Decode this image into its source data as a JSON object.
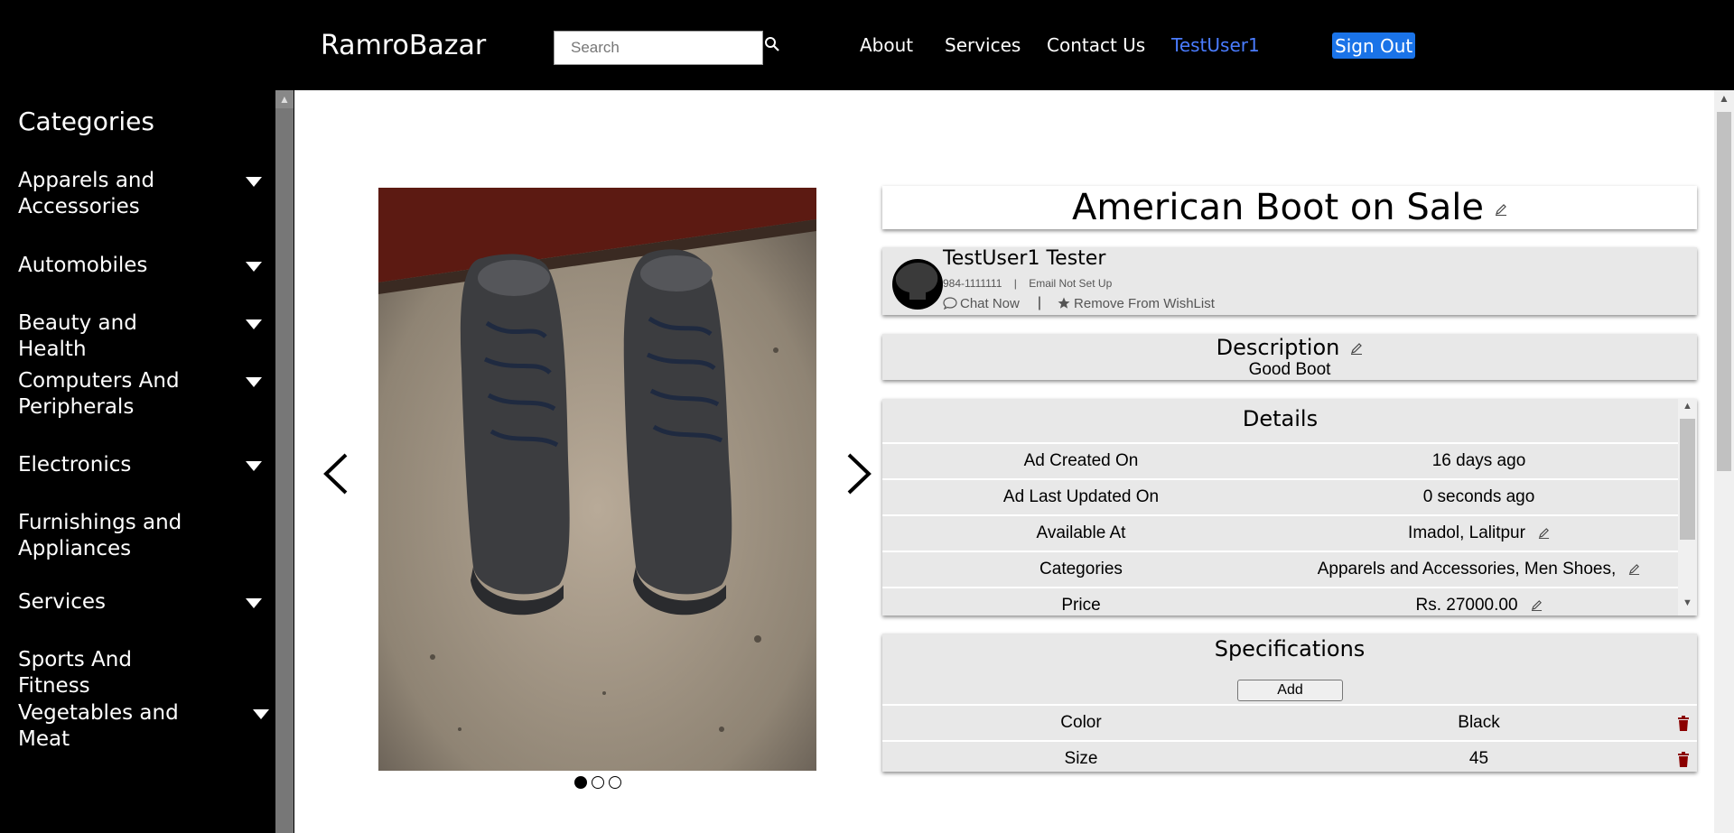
{
  "header": {
    "brand": "RamroBazar",
    "search_placeholder": "Search",
    "nav": {
      "about": "About",
      "services": "Services",
      "contact": "Contact Us",
      "user": "TestUser1"
    },
    "signout": "Sign Out"
  },
  "sidebar": {
    "title": "Categories",
    "items": [
      {
        "label": "Apparels and Accessories",
        "expandable": true
      },
      {
        "label": "Automobiles",
        "expandable": true
      },
      {
        "label": "Beauty and Health",
        "expandable": true
      },
      {
        "label": "Computers And Peripherals",
        "expandable": true
      },
      {
        "label": "Electronics",
        "expandable": true
      },
      {
        "label": "Furnishings and Appliances",
        "expandable": false
      },
      {
        "label": "Services",
        "expandable": true
      },
      {
        "label": "Sports And Fitness",
        "expandable": false
      },
      {
        "label": "Vegetables and Meat",
        "expandable": true
      }
    ]
  },
  "carousel": {
    "total_slides": 3,
    "active_slide": 1
  },
  "ad": {
    "title": "American Boot on Sale",
    "seller": {
      "name": "TestUser1 Tester",
      "phone": "984-1111111",
      "email": "Email Not Set Up",
      "chat": "Chat Now",
      "wishlist": "Remove From WishList"
    },
    "description": {
      "title": "Description",
      "body": "Good Boot"
    },
    "details": {
      "title": "Details",
      "rows": [
        {
          "key": "Ad Created On",
          "value": "16 days ago"
        },
        {
          "key": "Ad Last Updated On",
          "value": "0 seconds ago"
        },
        {
          "key": "Available At",
          "value": "Imadol, Lalitpur"
        },
        {
          "key": "Categories",
          "value": "Apparels and Accessories, Men Shoes,"
        },
        {
          "key": "Price",
          "value": "Rs. 27000.00"
        }
      ]
    },
    "specifications": {
      "title": "Specifications",
      "add_label": "Add",
      "rows": [
        {
          "key": "Color",
          "value": "Black"
        },
        {
          "key": "Size",
          "value": "45"
        }
      ]
    }
  },
  "colors": {
    "accent": "#1a73e8",
    "user_link": "#4a7cff",
    "delete": "#8b0000"
  }
}
